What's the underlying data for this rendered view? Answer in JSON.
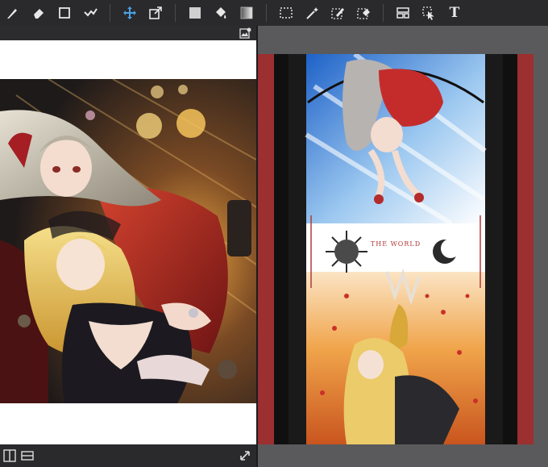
{
  "toolbar": {
    "groups": [
      [
        "brush-icon",
        "eraser-icon",
        "rectangle-tool-icon",
        "check-select-icon"
      ],
      [
        "move-icon",
        "transform-icon"
      ],
      [
        "fill-color-icon",
        "paint-bucket-icon",
        "gradient-icon"
      ],
      [
        "selection-rect-icon",
        "magic-wand-icon",
        "selection-pen-icon",
        "selection-eraser-icon"
      ],
      [
        "layer-panel-icon",
        "select-move-icon",
        "text-tool-icon"
      ]
    ],
    "text_tool_glyph": "T"
  },
  "left_artwork": {
    "description_colors": {
      "background": "#3a2a1e",
      "dress": "#b02a24",
      "hair_silver": "#c9c3b5",
      "hair_blonde": "#f0d16a"
    }
  },
  "right_artwork": {
    "tarot_title": "THE WORLD",
    "border_color": "#9c2f2f",
    "inner_frame": "#111111"
  },
  "colors": {
    "toolbar_bg": "#2a2a2c",
    "accent_blue": "#4aa3e8",
    "panel_bg": "#4b4b4d"
  }
}
